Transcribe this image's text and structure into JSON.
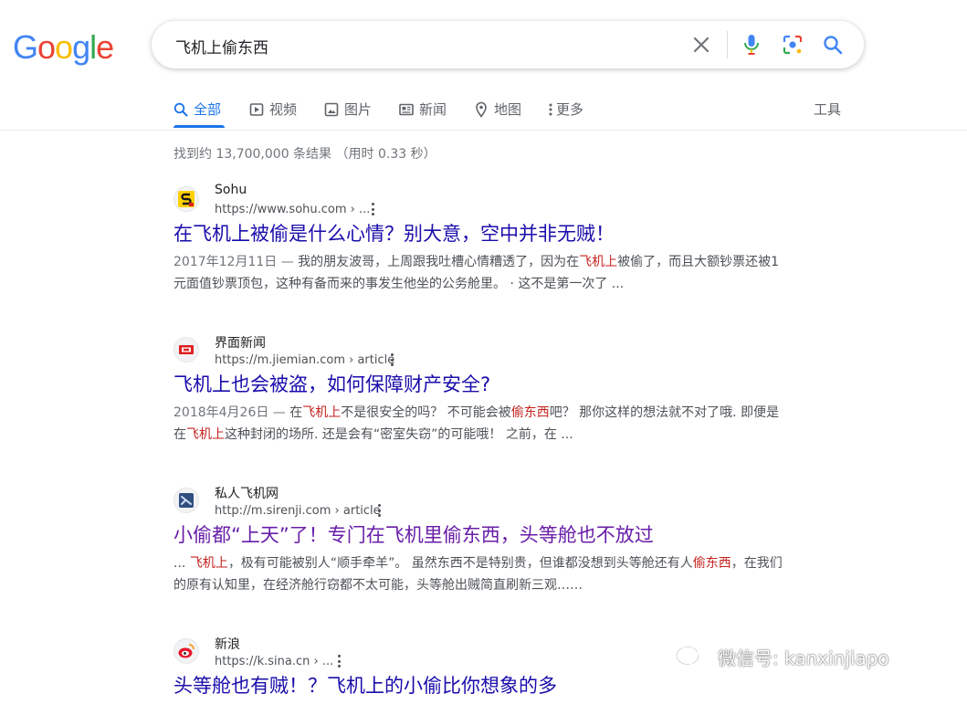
{
  "logo": {
    "letters": [
      "G",
      "o",
      "o",
      "g",
      "l",
      "e"
    ],
    "colors": [
      "#4285F4",
      "#EA4335",
      "#FBBC05",
      "#4285F4",
      "#34A853",
      "#EA4335"
    ]
  },
  "search": {
    "query": "飞机上偷东西"
  },
  "tabs": [
    {
      "label": "全部",
      "icon": "search-icon"
    },
    {
      "label": "视频",
      "icon": "play-icon"
    },
    {
      "label": "图片",
      "icon": "image-icon"
    },
    {
      "label": "新闻",
      "icon": "news-icon"
    },
    {
      "label": "地图",
      "icon": "map-pin-icon"
    },
    {
      "label": "更多",
      "icon": "more-vert-icon"
    }
  ],
  "tools_label": "工具",
  "result_stats": "找到约 13,700,000 条结果 （用时 0.33 秒）",
  "results": [
    {
      "site": "Sohu",
      "url": "https://www.sohu.com › ...",
      "title": "在飞机上被偷是什么心情？别大意，空中并非无贼！",
      "snippet": {
        "date": "2017年12月11日 — ",
        "p1": "我的朋友波哥，上周跟我吐槽心情糟透了，因为在",
        "e1": "飞机上",
        "p2": "被偷了，而且大额钞票还被1元面值钞票顶包，这种有备而来的事发生他坐的公务舱里。 · 这不是第一次了 ..."
      }
    },
    {
      "site": "界面新闻",
      "url": "https://m.jiemian.com › article",
      "title": "飞机上也会被盗，如何保障财产安全?",
      "snippet": {
        "date": "2018年4月26日 — ",
        "p1": "在",
        "e1": "飞机上",
        "p2": "不是很安全的吗？ 不可能会被",
        "e2": "偷东西",
        "p3": "吧？ 那你这样的想法就不对了哦. 即便是在",
        "e3": "飞机上",
        "p4": "这种封闭的场所. 还是会有“密室失窃”的可能哦！ 之前，在 ..."
      }
    },
    {
      "site": "私人飞机网",
      "url": "http://m.sirenji.com › article",
      "title": "小偷都“上天”了！专门在飞机里偷东西，头等舱也不放过",
      "snippet": {
        "p1": "... ",
        "e1": "飞机上",
        "p2": "，极有可能被别人“顺手牵羊”。 虽然东西不是特别贵，但谁都没想到头等舱还有人",
        "e2": "偷东西",
        "p3": "，在我们的原有认知里，在经济舱行窃都不太可能，头等舱出贼简直刷新三观……"
      }
    },
    {
      "site": "新浪",
      "url": "https://k.sina.cn › ...",
      "title": "头等舱也有贼！？飞机上的小偷比你想象的多"
    }
  ],
  "watermark": "微信号: kanxinjiapo"
}
